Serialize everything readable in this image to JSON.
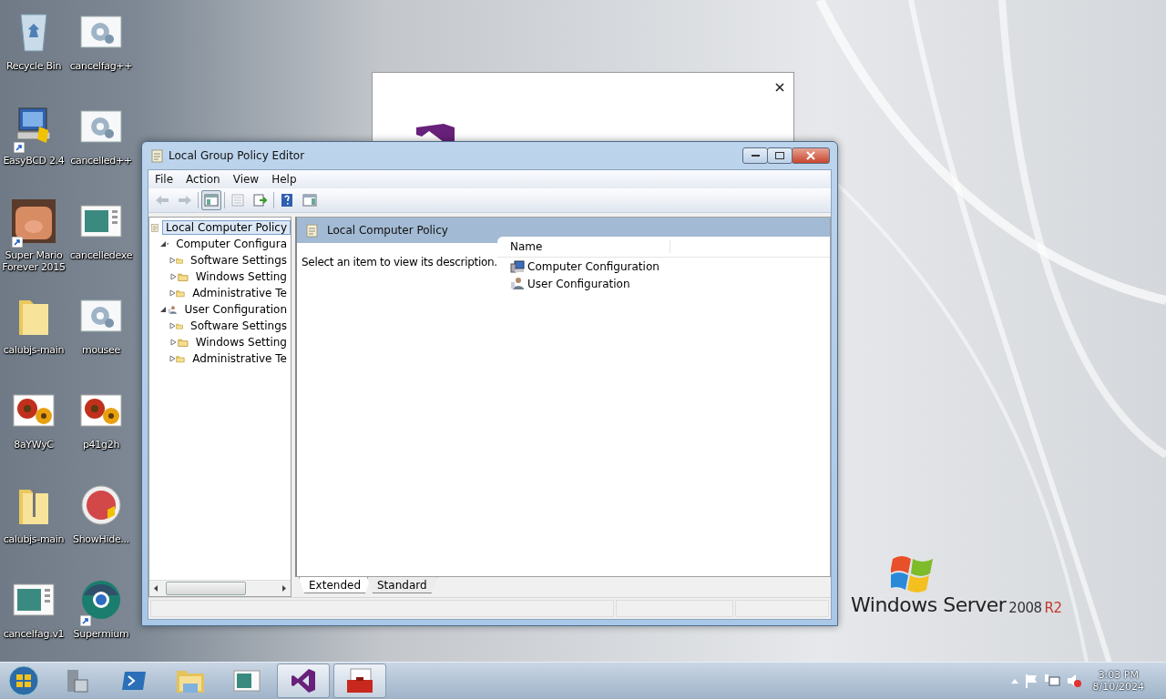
{
  "desktop_icons": [
    {
      "label": "Recycle Bin",
      "kind": "bin",
      "shortcut": false
    },
    {
      "label": "cancelfag++",
      "kind": "gear",
      "shortcut": false
    },
    {
      "label": "EasyBCD 2.4",
      "kind": "monitor",
      "shortcut": true
    },
    {
      "label": "cancelled++",
      "kind": "gear",
      "shortcut": false
    },
    {
      "label": "Super Mario Forever 2015",
      "kind": "game",
      "shortcut": true
    },
    {
      "label": "cancelledexe",
      "kind": "doc",
      "shortcut": false
    },
    {
      "label": "calubjs-main",
      "kind": "folder",
      "shortcut": false
    },
    {
      "label": "mousee",
      "kind": "gear",
      "shortcut": false
    },
    {
      "label": "8aYWyC",
      "kind": "flower",
      "shortcut": false
    },
    {
      "label": "p41g2h",
      "kind": "flower",
      "shortcut": false
    },
    {
      "label": "calubjs-main",
      "kind": "zip",
      "shortcut": false
    },
    {
      "label": "ShowHide...",
      "kind": "badge",
      "shortcut": false
    },
    {
      "label": "cancelfag.v1",
      "kind": "doc",
      "shortcut": false
    },
    {
      "label": "Supermium",
      "kind": "globe",
      "shortcut": true
    }
  ],
  "wallpaper_logo": {
    "brand": "Windows Server",
    "version": "2008",
    "edition": "R2"
  },
  "window": {
    "title": "Local Group Policy Editor",
    "menu": [
      "File",
      "Action",
      "View",
      "Help"
    ],
    "toolbar": [
      {
        "kind": "back",
        "disabled": true
      },
      {
        "kind": "forward",
        "disabled": true
      },
      {
        "kind": "sep"
      },
      {
        "kind": "tree",
        "selected": true
      },
      {
        "kind": "sep"
      },
      {
        "kind": "props",
        "disabled": true
      },
      {
        "kind": "export",
        "disabled": false
      },
      {
        "kind": "sep"
      },
      {
        "kind": "help",
        "disabled": false
      },
      {
        "kind": "pane",
        "disabled": false
      }
    ],
    "tree": [
      {
        "label": "Local Computer Policy",
        "kind": "policy",
        "selected": true,
        "children": [
          {
            "label": "Computer Configura",
            "kind": "computer",
            "selected": false,
            "expanded": true,
            "children": [
              {
                "label": "Software Settings",
                "kind": "folder",
                "selected": false,
                "expanded": false
              },
              {
                "label": "Windows Setting",
                "kind": "folder",
                "selected": false,
                "expanded": false
              },
              {
                "label": "Administrative Te",
                "kind": "folder",
                "selected": false,
                "expanded": false
              }
            ]
          },
          {
            "label": "User Configuration",
            "kind": "user",
            "selected": false,
            "expanded": true,
            "children": [
              {
                "label": "Software Settings",
                "kind": "folder",
                "selected": false,
                "expanded": false
              },
              {
                "label": "Windows Setting",
                "kind": "folder",
                "selected": false,
                "expanded": false
              },
              {
                "label": "Administrative Te",
                "kind": "folder",
                "selected": false,
                "expanded": false
              }
            ]
          }
        ]
      }
    ],
    "details": {
      "header": "Local Computer Policy",
      "description": "Select an item to view its description.",
      "columns": [
        "Name"
      ],
      "items": [
        {
          "label": "Computer Configuration",
          "kind": "computer"
        },
        {
          "label": "User Configuration",
          "kind": "user"
        }
      ]
    },
    "tabs": [
      {
        "label": "Extended",
        "selected": true
      },
      {
        "label": "Standard",
        "selected": false
      }
    ]
  },
  "taskbar": {
    "apps": [
      {
        "kind": "server",
        "active": false
      },
      {
        "kind": "shell",
        "active": false
      },
      {
        "kind": "explorer",
        "active": false
      },
      {
        "kind": "doc",
        "active": false
      },
      {
        "kind": "vs",
        "active": true
      },
      {
        "kind": "toolbox",
        "active": true
      }
    ],
    "clock": {
      "time": "3:03 PM",
      "date": "8/10/2024"
    }
  }
}
